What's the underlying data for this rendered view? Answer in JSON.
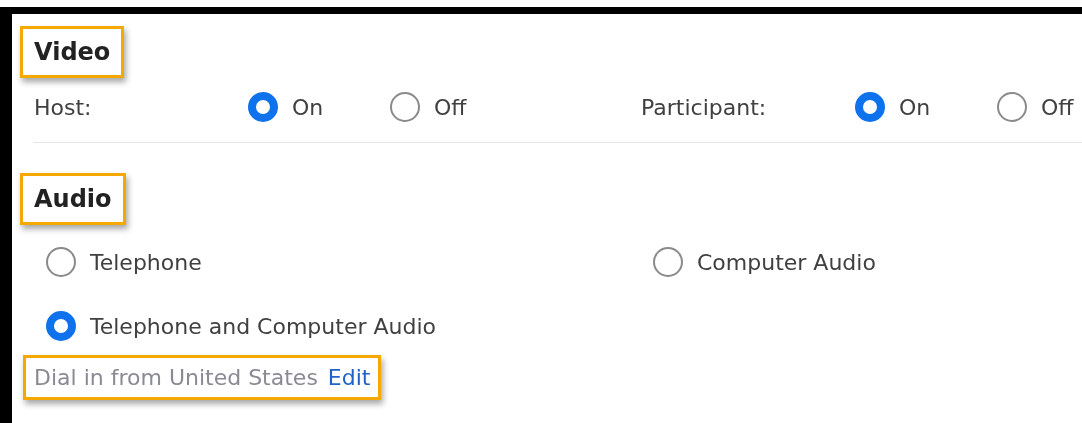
{
  "video": {
    "title": "Video",
    "highlighted": true,
    "groups": [
      {
        "label": "Host:",
        "options": [
          {
            "label": "On",
            "selected": true
          },
          {
            "label": "Off",
            "selected": false
          }
        ]
      },
      {
        "label": "Participant:",
        "options": [
          {
            "label": "On",
            "selected": true
          },
          {
            "label": "Off",
            "selected": false
          }
        ]
      }
    ]
  },
  "audio": {
    "title": "Audio",
    "highlighted": true,
    "options": [
      {
        "label": "Telephone",
        "selected": false
      },
      {
        "label": "Computer Audio",
        "selected": false
      },
      {
        "label": "Telephone and Computer Audio",
        "selected": true
      }
    ],
    "dial_in": {
      "text": "Dial in from United States",
      "link": "Edit",
      "highlighted": true
    }
  }
}
